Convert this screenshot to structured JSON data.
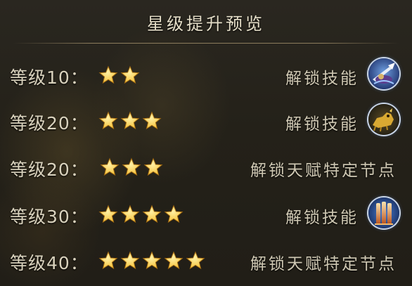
{
  "title": "星级提升预览",
  "rows": [
    {
      "level_label": "等级10：",
      "stars": 2,
      "unlock_text": "解锁技能",
      "unlock_type": "skill",
      "icon": "spear-strike-icon"
    },
    {
      "level_label": "等级20：",
      "stars": 3,
      "unlock_text": "解锁技能",
      "unlock_type": "skill",
      "icon": "golden-beast-icon"
    },
    {
      "level_label": "等级20：",
      "stars": 3,
      "unlock_text": "解锁天赋特定节点",
      "unlock_type": "talent"
    },
    {
      "level_label": "等级30：",
      "stars": 4,
      "unlock_text": "解锁技能",
      "unlock_type": "skill",
      "icon": "flame-pillars-icon"
    },
    {
      "level_label": "等级40：",
      "stars": 5,
      "unlock_text": "解锁天赋特定节点",
      "unlock_type": "talent"
    }
  ],
  "colors": {
    "star_fill": "#f6c33c",
    "star_highlight": "#fff1a6",
    "text": "#d9d2bd"
  }
}
